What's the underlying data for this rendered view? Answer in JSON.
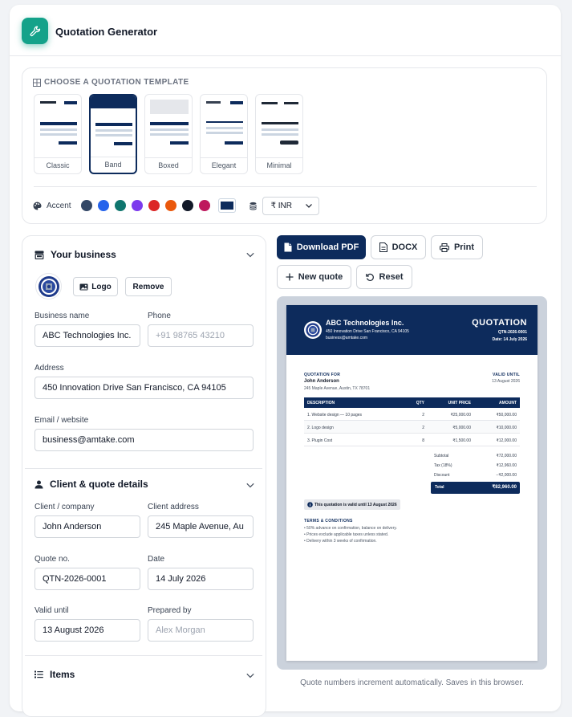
{
  "app": {
    "title": "Quotation Generator"
  },
  "templates": {
    "heading": "CHOOSE A QUOTATION TEMPLATE",
    "items": [
      {
        "label": "Classic",
        "selected": false
      },
      {
        "label": "Band",
        "selected": true
      },
      {
        "label": "Boxed",
        "selected": false
      },
      {
        "label": "Elegant",
        "selected": false
      },
      {
        "label": "Minimal",
        "selected": false
      }
    ],
    "accent_label": "Accent",
    "accent_colors": [
      "#334766",
      "#2563eb",
      "#0f766e",
      "#7c3aed",
      "#dc2626",
      "#ea580c",
      "#111827",
      "#be185d"
    ],
    "selected_accent": "#0d2b5c",
    "currency": "₹ INR"
  },
  "business": {
    "section_title": "Your business",
    "logo_button": "Logo",
    "remove_button": "Remove",
    "name_label": "Business name",
    "name_value": "ABC Technologies Inc.",
    "phone_label": "Phone",
    "phone_placeholder": "+91 98765 43210",
    "address_label": "Address",
    "address_value": "450 Innovation Drive San Francisco, CA 94105",
    "email_label": "Email / website",
    "email_value": "business@amtake.com"
  },
  "client": {
    "section_title": "Client & quote details",
    "company_label": "Client / company",
    "company_value": "John Anderson",
    "address_label": "Client address",
    "address_value": "245 Maple Avenue, Au",
    "quote_no_label": "Quote no.",
    "quote_no_value": "QTN-2026-0001",
    "date_label": "Date",
    "date_value": "14 July 2026",
    "valid_label": "Valid until",
    "valid_value": "13 August 2026",
    "prepared_label": "Prepared by",
    "prepared_placeholder": "Alex Morgan"
  },
  "items_section": {
    "title": "Items"
  },
  "actions": {
    "download_pdf": "Download PDF",
    "docx": "DOCX",
    "print": "Print",
    "new_quote": "New quote",
    "reset": "Reset"
  },
  "preview": {
    "company": "ABC Technologies Inc.",
    "company_address": "450 Innovation Drive San Francisco, CA 94105",
    "company_email": "business@amtake.com",
    "doc_title": "QUOTATION",
    "quote_no": "QTN-2026-0001",
    "date_line": "Date: 14 July 2026",
    "for_label": "QUOTATION FOR",
    "client_name": "John Anderson",
    "client_address": "245 Maple Avenue, Austin, TX 78701",
    "valid_label": "VALID UNTIL",
    "valid_value": "13 August 2026",
    "columns": [
      "DESCRIPTION",
      "QTY",
      "UNIT PRICE",
      "AMOUNT"
    ],
    "rows": [
      {
        "desc": "1. Website design — 10 pages",
        "qty": "2",
        "price": "₹25,000.00",
        "amount": "₹50,000.00"
      },
      {
        "desc": "2. Logo design",
        "qty": "2",
        "price": "₹5,000.00",
        "amount": "₹10,000.00"
      },
      {
        "desc": "3. Plugin Cost",
        "qty": "8",
        "price": "₹1,500.00",
        "amount": "₹12,000.00"
      }
    ],
    "subtotal_label": "Subtotal",
    "subtotal_value": "₹72,000.00",
    "tax_label": "Tax (18%)",
    "tax_value": "₹12,960.00",
    "discount_label": "Discount",
    "discount_value": "−₹2,000.00",
    "total_label": "Total",
    "total_value": "₹82,960.00",
    "validity_note": "This quotation is valid until 13 August 2026",
    "terms_title": "TERMS & CONDITIONS",
    "terms": [
      "50% advance on confirmation, balance on delivery.",
      "Prices exclude applicable taxes unless stated.",
      "Delivery within 3 weeks of confirmation."
    ]
  },
  "footer_note": "Quote numbers increment automatically. Saves in this browser."
}
